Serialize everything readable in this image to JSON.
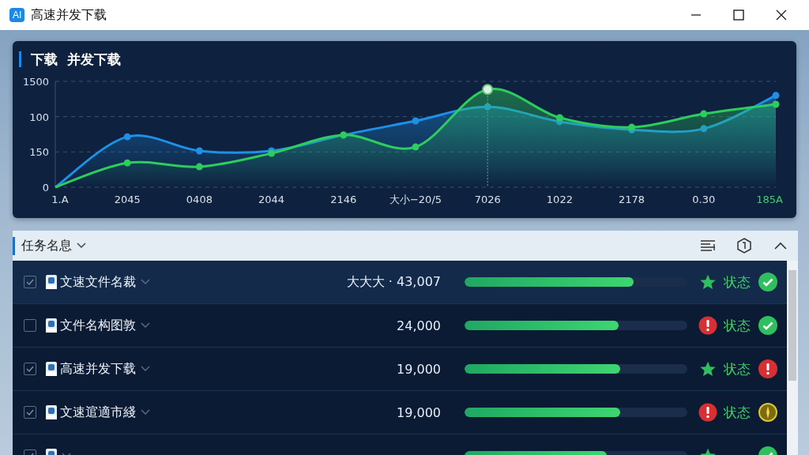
{
  "window": {
    "title": "高速并发下载",
    "logo": "AI"
  },
  "chart_panel": {
    "title": "下载  并发下载",
    "y_labels": [
      "1500",
      "100",
      "150",
      "0"
    ],
    "x_labels": [
      "1.A",
      "2045",
      "0408",
      "2044",
      "2146",
      "大小−20/5",
      "7026",
      "1022",
      "2178",
      "0.30",
      "185A"
    ]
  },
  "task_panel": {
    "title": "任务名息",
    "rows": [
      {
        "selected": true,
        "checked": true,
        "name": "文速文件名裁",
        "count": "大大大 · 43,007",
        "level": 0.76,
        "flag": {
          "kind": "star"
        },
        "status": "状态",
        "status_icon": {
          "kind": "check"
        }
      },
      {
        "selected": false,
        "checked": false,
        "name": "文件名构图敦",
        "count": "24,000",
        "level": 0.69,
        "flag": {
          "kind": "alert"
        },
        "status": "状态",
        "status_icon": {
          "kind": "check"
        }
      },
      {
        "selected": false,
        "checked": true,
        "name": "高速并发下载",
        "count": "19,000",
        "level": 0.7,
        "flag": {
          "kind": "star"
        },
        "status": "状态",
        "status_icon": {
          "kind": "alert"
        }
      },
      {
        "selected": false,
        "checked": true,
        "name": "文速逭適市綫",
        "count": "19,000",
        "level": 0.7,
        "flag": {
          "kind": "alert"
        },
        "status": "状态",
        "status_icon": {
          "kind": "pending"
        }
      },
      {
        "selected": false,
        "checked": true,
        "level": 0.64,
        "flag": {
          "kind": "star"
        },
        "status_icon": {
          "kind": "check"
        }
      }
    ]
  }
}
